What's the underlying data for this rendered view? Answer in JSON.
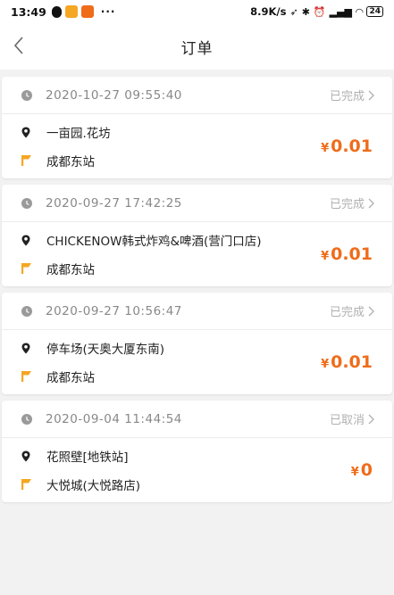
{
  "status_bar": {
    "time": "13:49",
    "net_speed": "8.9K/s",
    "battery": "24",
    "more_dots": "···"
  },
  "nav": {
    "title": "订单"
  },
  "currency": "¥",
  "colors": {
    "accent": "#ef6c1a",
    "flag": "#f5a623",
    "muted": "#888888",
    "status": "#b0b0b0"
  },
  "orders": [
    {
      "time": "2020-10-27 09:55:40",
      "status": "已完成",
      "from": "一亩园.花坊",
      "to": "成都东站",
      "amount": "0.01"
    },
    {
      "time": "2020-09-27 17:42:25",
      "status": "已完成",
      "from": "CHICKENOW韩式炸鸡&啤酒(营门口店)",
      "to": "成都东站",
      "amount": "0.01"
    },
    {
      "time": "2020-09-27 10:56:47",
      "status": "已完成",
      "from": "停车场(天奥大厦东南)",
      "to": "成都东站",
      "amount": "0.01"
    },
    {
      "time": "2020-09-04 11:44:54",
      "status": "已取消",
      "from": "花照壁[地铁站]",
      "to": "大悦城(大悦路店)",
      "amount": "0"
    }
  ]
}
